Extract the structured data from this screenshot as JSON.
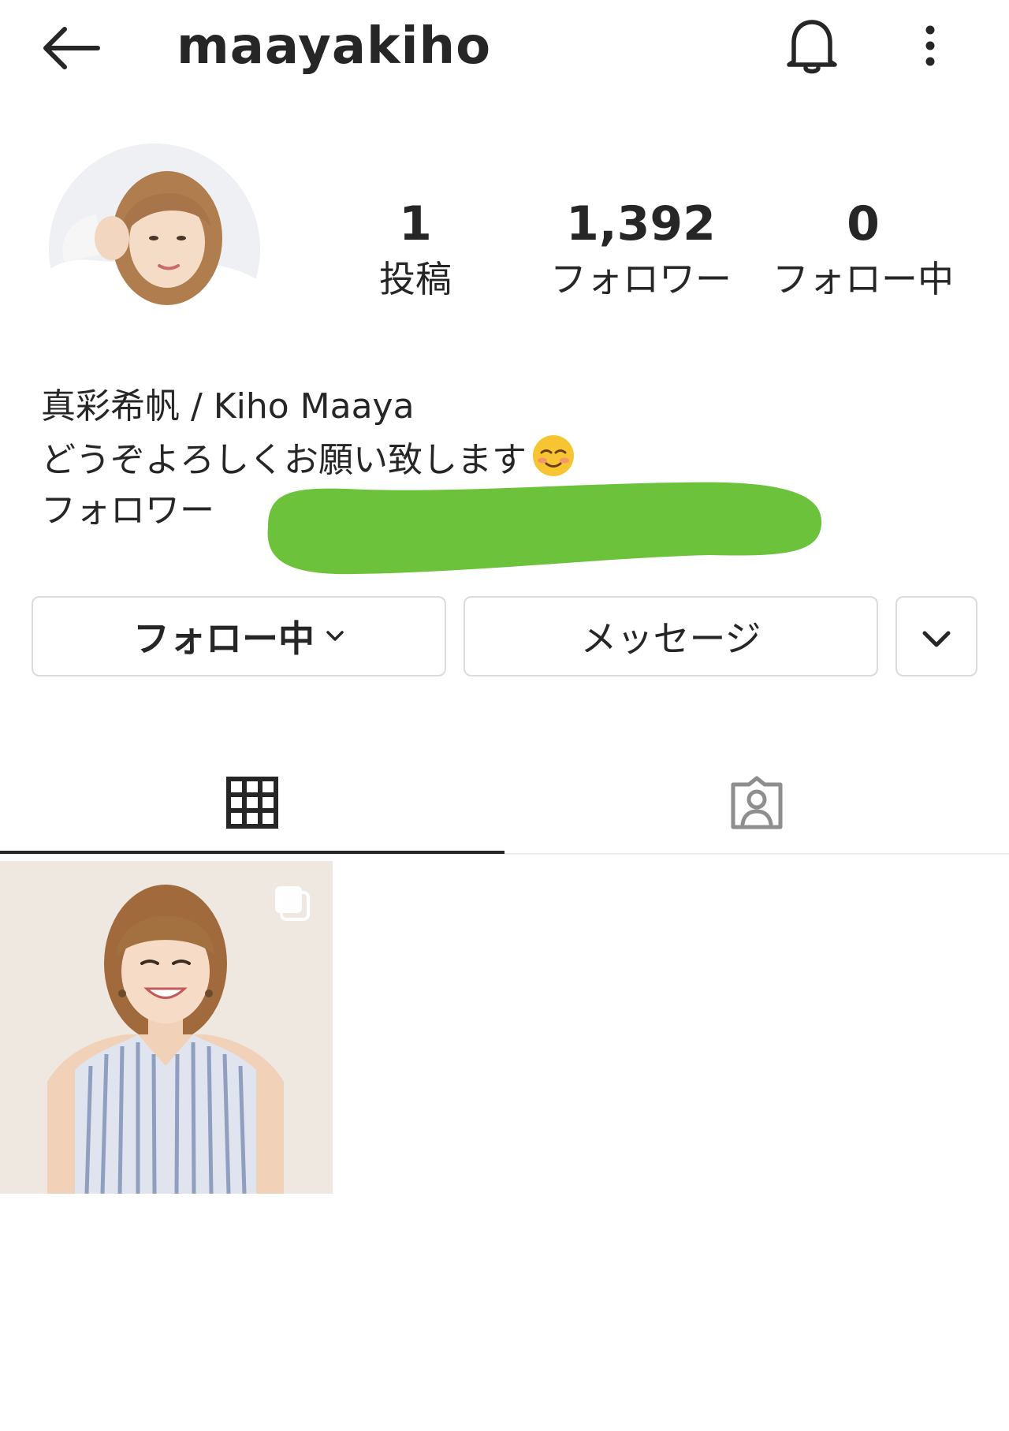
{
  "header": {
    "username": "maayakiho",
    "back_icon": "arrow-left-icon",
    "notification_icon": "bell-icon",
    "more_icon": "more-vertical-icon"
  },
  "profile": {
    "stats": [
      {
        "value": "1",
        "label": "投稿"
      },
      {
        "value": "1,392",
        "label": "フォロワー"
      },
      {
        "value": "0",
        "label": "フォロー中"
      }
    ],
    "bio": {
      "name": "真彩希帆 / Kiho Maaya",
      "line1": "どうぞよろしくお願い致します",
      "line1_emoji": "smiling-face-emoji",
      "line2": "フォロワー"
    }
  },
  "actions": {
    "following_label": "フォロー中",
    "message_label": "メッセージ",
    "suggest_icon": "chevron-down-icon"
  },
  "tabs": [
    {
      "name": "grid",
      "icon": "grid-icon",
      "active": true
    },
    {
      "name": "tagged",
      "icon": "tagged-person-icon",
      "active": false
    }
  ],
  "colors": {
    "text": "#262626",
    "border": "#dbdbdb",
    "redaction": "#6cc23b"
  }
}
